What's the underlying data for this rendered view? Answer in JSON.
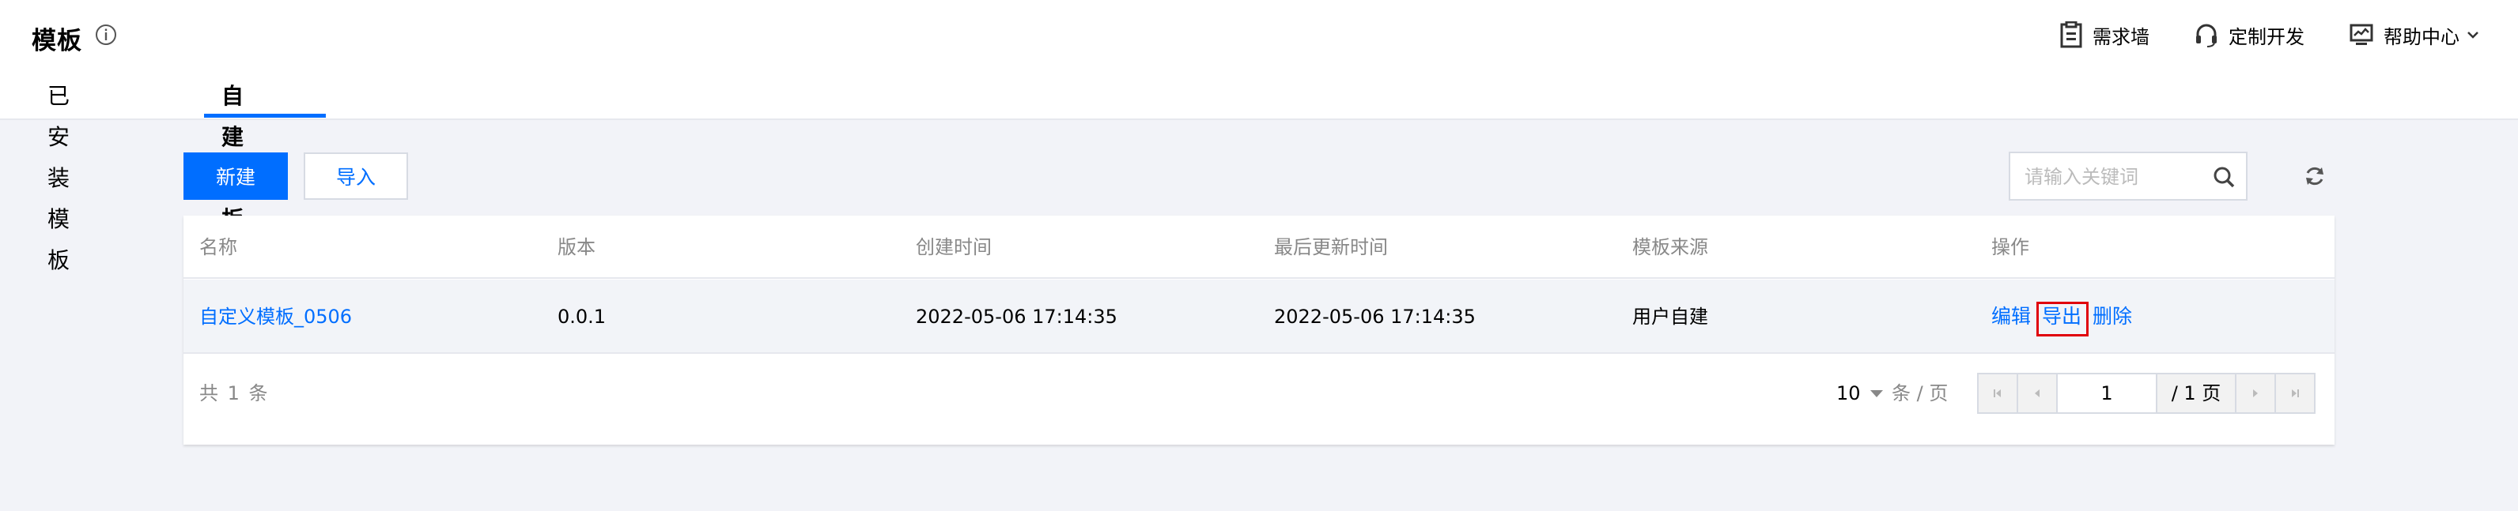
{
  "header": {
    "title": "模板",
    "nav": [
      {
        "label": "需求墙",
        "icon": "clipboard-icon"
      },
      {
        "label": "定制开发",
        "icon": "headset-icon"
      },
      {
        "label": "帮助中心",
        "icon": "monitor-icon"
      }
    ],
    "tabs": [
      {
        "label": "已安装模板",
        "active": false
      },
      {
        "label": "自建模板",
        "active": true
      }
    ]
  },
  "toolbar": {
    "new_label": "新建",
    "import_label": "导入",
    "search_placeholder": "请输入关键词",
    "search_value": ""
  },
  "table": {
    "columns": [
      "名称",
      "版本",
      "创建时间",
      "最后更新时间",
      "模板来源",
      "操作"
    ],
    "rows": [
      {
        "name": "自定义模板_0506",
        "version": "0.0.1",
        "created": "2022-05-06 17:14:35",
        "updated": "2022-05-06 17:14:35",
        "source": "用户自建",
        "actions": [
          "编辑",
          "导出",
          "删除"
        ]
      }
    ]
  },
  "pagination": {
    "total_text": "共 1 条",
    "page_size": "10",
    "per_page_label": "条 / 页",
    "current_page": "1",
    "total_pages_text": "/ 1 页"
  },
  "colors": {
    "accent": "#006eff",
    "highlight": "#e0000a",
    "background": "#f2f3f8"
  }
}
